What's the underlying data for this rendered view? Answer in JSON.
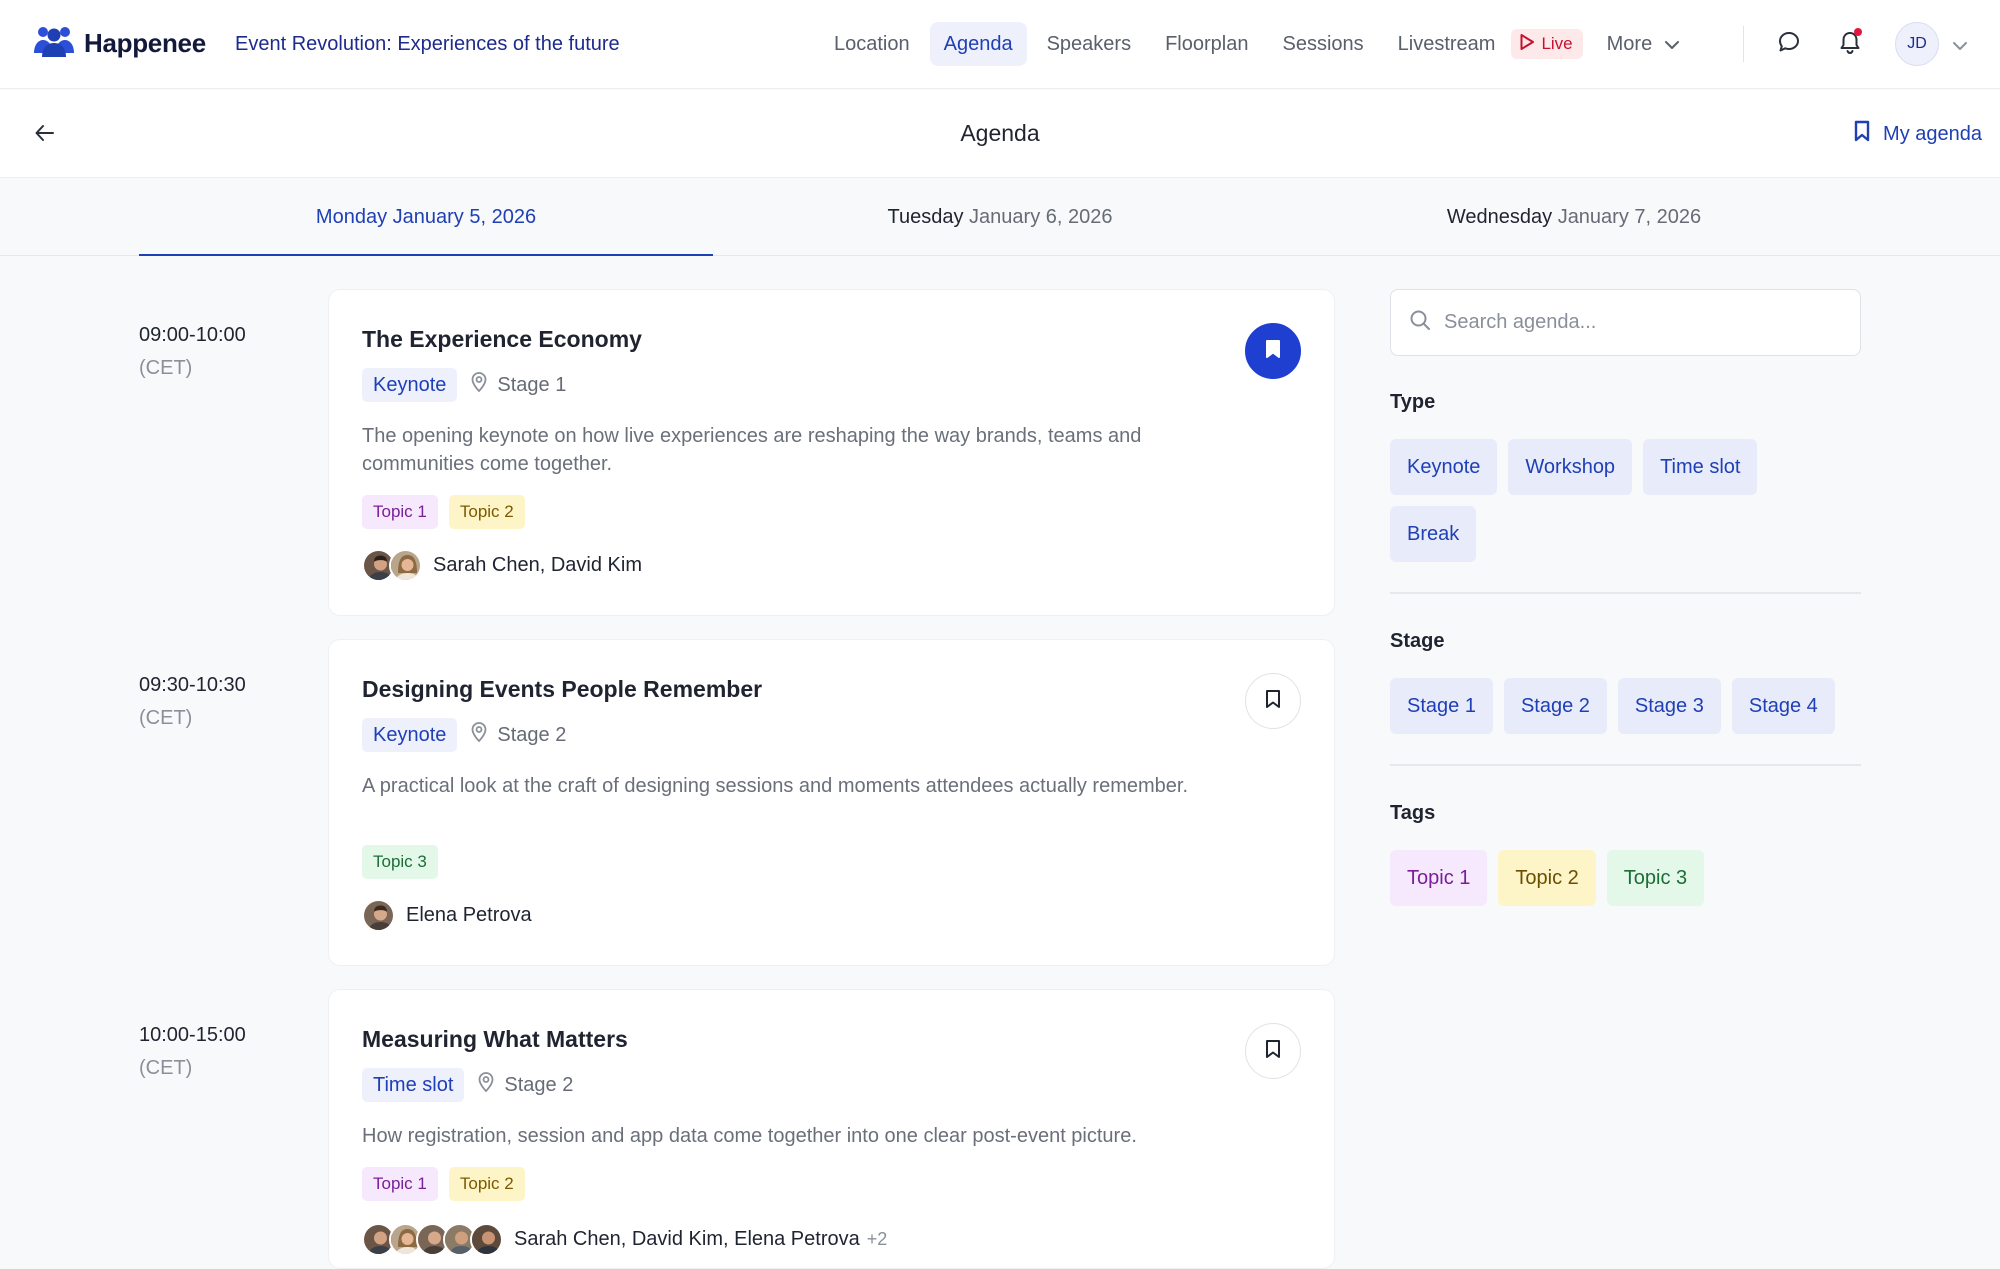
{
  "app": {
    "brand_name": "Happenee",
    "event_title": "Event Revolution: Experiences of the future"
  },
  "nav": {
    "items": [
      {
        "label": "Location"
      },
      {
        "label": "Agenda",
        "active": true
      },
      {
        "label": "Speakers"
      },
      {
        "label": "Floorplan"
      },
      {
        "label": "Sessions"
      },
      {
        "label": "Livestream"
      }
    ],
    "live_label": "Live",
    "more_label": "More"
  },
  "user": {
    "initials": "JD"
  },
  "page": {
    "title": "Agenda",
    "my_agenda_label": "My agenda"
  },
  "days": [
    {
      "dow": "Monday",
      "date": "January 5, 2026",
      "active": true
    },
    {
      "dow": "Tuesday",
      "date": "January 6, 2026",
      "active": false
    },
    {
      "dow": "Wednesday",
      "date": "January 7, 2026",
      "active": false
    }
  ],
  "sessions": [
    {
      "time": "09:00-10:00",
      "tz": "(CET)",
      "title": "The Experience Economy",
      "type": "Keynote",
      "stage": "Stage 1",
      "description": "The opening keynote on how live experiences are reshaping the way brands, teams and communities come together.",
      "tags": [
        "Topic 1",
        "Topic 2"
      ],
      "speakers": "Sarah Chen, David Kim",
      "speakers_more": "",
      "bookmarked": true
    },
    {
      "time": "09:30-10:30",
      "tz": "(CET)",
      "title": "Designing Events People Remember",
      "type": "Keynote",
      "stage": "Stage 2",
      "description": "A practical look at the craft of designing sessions and moments attendees actually remember.",
      "tags": [
        "Topic 3"
      ],
      "speakers": "Elena Petrova",
      "speakers_more": "",
      "bookmarked": false
    },
    {
      "time": "10:00-15:00",
      "tz": "(CET)",
      "title": "Measuring What Matters",
      "type": "Time slot",
      "stage": "Stage 2",
      "description": "How registration, session and app data come together into one clear post-event picture.",
      "tags": [
        "Topic 1",
        "Topic 2"
      ],
      "speakers": "Sarah Chen, David Kim, Elena Petrova",
      "speakers_more": "+2",
      "bookmarked": false
    }
  ],
  "filters": {
    "search_placeholder": "Search agenda...",
    "type": {
      "heading": "Type",
      "options": [
        "Keynote",
        "Workshop",
        "Time slot",
        "Break"
      ]
    },
    "stage": {
      "heading": "Stage",
      "options": [
        "Stage 1",
        "Stage 2",
        "Stage 3",
        "Stage 4"
      ]
    },
    "tags": {
      "heading": "Tags",
      "options": [
        "Topic 1",
        "Topic 2",
        "Topic 3"
      ]
    }
  },
  "colors": {
    "accent": "#1f3fb5",
    "saved_bookmark": "#1f3fd1",
    "live": "#c8102e",
    "topic_1": "#f6e9fd",
    "topic_2": "#fdf5c8",
    "topic_3": "#e3f8e9"
  },
  "icons": {
    "brand": "people-group-icon",
    "live": "play-icon",
    "more": "chevron-down-icon",
    "chat": "chat-bubble-icon",
    "notifications": "bell-icon",
    "back": "arrow-left-icon",
    "my_agenda": "bookmark-icon",
    "stage": "map-pin-icon",
    "search": "search-icon"
  }
}
